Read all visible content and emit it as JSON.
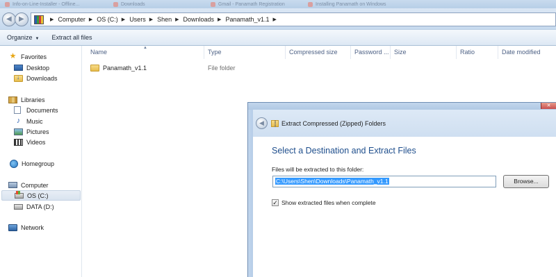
{
  "tabs": [
    {
      "label": "Info-on-Line-Installer - Offline..."
    },
    {
      "label": "Downloads"
    },
    {
      "label": "Gmail - Panamath Registration"
    },
    {
      "label": "Installing Panamath on Windows"
    }
  ],
  "address": {
    "crumbs": [
      "Computer",
      "OS (C:)",
      "Users",
      "Shen",
      "Downloads",
      "Panamath_v1.1"
    ]
  },
  "toolbar": {
    "organize_label": "Organize",
    "extract_all_label": "Extract all files"
  },
  "nav": {
    "favorites": "Favorites",
    "desktop": "Desktop",
    "downloads": "Downloads",
    "libraries": "Libraries",
    "documents": "Documents",
    "music": "Music",
    "pictures": "Pictures",
    "videos": "Videos",
    "homegroup": "Homegroup",
    "computer": "Computer",
    "os_drive": "OS (C:)",
    "data_drive": "DATA (D:)",
    "network": "Network"
  },
  "columns": {
    "name": "Name",
    "type": "Type",
    "compressed_size": "Compressed size",
    "password": "Password ...",
    "size": "Size",
    "ratio": "Ratio",
    "date_modified": "Date modified"
  },
  "files": [
    {
      "name": "Panamath_v1.1",
      "type": "File folder"
    }
  ],
  "dialog": {
    "title": "Extract Compressed (Zipped) Folders",
    "heading": "Select a Destination and Extract Files",
    "path_label": "Files will be extracted to this folder:",
    "path_value": "C:\\Users\\Shen\\Downloads\\Panamath_v1.1",
    "browse_label": "Browse...",
    "show_files_label": "Show extracted files when complete",
    "show_files_checked": true
  }
}
